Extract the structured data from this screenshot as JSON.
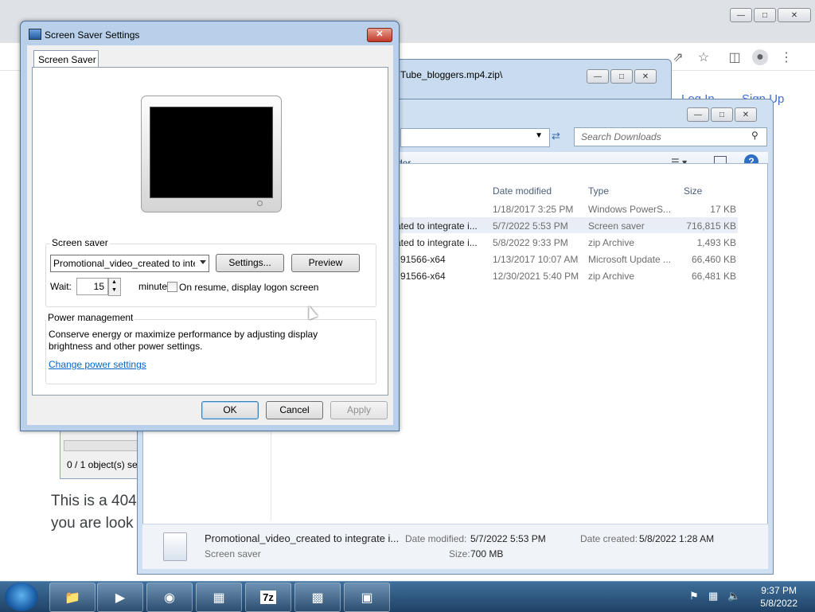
{
  "browser": {
    "header_links": [
      "Log In",
      "Sign Up"
    ],
    "page_text_1": "This is a 404",
    "page_text_2": "you are look"
  },
  "sevenzip": {
    "title": "Tube_bloggers.mp4.zip\\",
    "status": "0 / 1 object(s) se"
  },
  "explorer": {
    "search_placeholder": "Search Downloads",
    "toolbar_fragment": "der",
    "columns": [
      "Date modified",
      "Type",
      "Size"
    ],
    "rows": [
      {
        "name": "",
        "date": "1/18/2017 3:25 PM",
        "type": "Windows PowerS...",
        "size": "17 KB"
      },
      {
        "name": "ated to integrate i...",
        "date": "5/7/2022 5:53 PM",
        "type": "Screen saver",
        "size": "716,815 KB"
      },
      {
        "name": "ated to integrate i...",
        "date": "5/8/2022 9:33 PM",
        "type": "zip Archive",
        "size": "1,493 KB"
      },
      {
        "name": "91566-x64",
        "date": "1/13/2017 10:07 AM",
        "type": "Microsoft Update ...",
        "size": "66,460 KB"
      },
      {
        "name": "91566-x64",
        "date": "12/30/2021 5:40 PM",
        "type": "zip Archive",
        "size": "66,481 KB"
      }
    ],
    "details": {
      "filename": "Promotional_video_created to integrate i...",
      "filetype": "Screen saver",
      "date_modified_label": "Date modified:",
      "date_modified": "5/7/2022 5:53 PM",
      "size_label": "Size:",
      "size": "700 MB",
      "date_created_label": "Date created:",
      "date_created": "5/8/2022 1:28 AM"
    }
  },
  "dialog": {
    "title": "Screen Saver Settings",
    "tab": "Screen Saver",
    "screensaver_group": "Screen saver",
    "selected_screensaver": "Promotional_video_created to integrate",
    "settings_button": "Settings...",
    "preview_button": "Preview",
    "wait_label": "Wait:",
    "wait_value": "15",
    "minutes_label": "minutes",
    "resume_label": "On resume, display logon screen",
    "power_group": "Power management",
    "power_text_1": "Conserve energy or maximize performance by adjusting display",
    "power_text_2": "brightness and other power settings.",
    "power_link": "Change power settings",
    "ok": "OK",
    "cancel": "Cancel",
    "apply": "Apply"
  },
  "taskbar": {
    "time": "9:37 PM",
    "date": "5/8/2022",
    "sevenzip_label": "7z"
  }
}
